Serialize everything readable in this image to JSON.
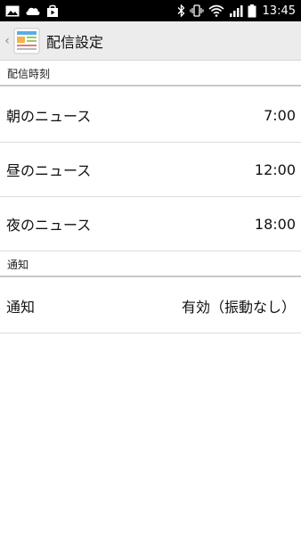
{
  "status_bar": {
    "time": "13:45",
    "left_icons": [
      "image-icon",
      "cloud-icon",
      "shopping-bag-icon"
    ],
    "right_icons": [
      "bluetooth-icon",
      "vibrate-icon",
      "wifi-icon",
      "cellular-signal-icon",
      "battery-icon"
    ]
  },
  "action_bar": {
    "back_glyph": "‹",
    "app_icon": "news-app-icon",
    "title": "配信設定"
  },
  "sections": {
    "delivery_time": {
      "header": "配信時刻",
      "items": [
        {
          "label": "朝のニュース",
          "value": "7:00"
        },
        {
          "label": "昼のニュース",
          "value": "12:00"
        },
        {
          "label": "夜のニュース",
          "value": "18:00"
        }
      ]
    },
    "notification": {
      "header": "通知",
      "items": [
        {
          "label": "通知",
          "value": "有効（振動なし）"
        }
      ]
    }
  },
  "colors": {
    "status_bar_bg": "#000000",
    "action_bar_bg": "#ececec",
    "divider": "#dcdcdc",
    "section_divider": "#c8c8c8"
  }
}
